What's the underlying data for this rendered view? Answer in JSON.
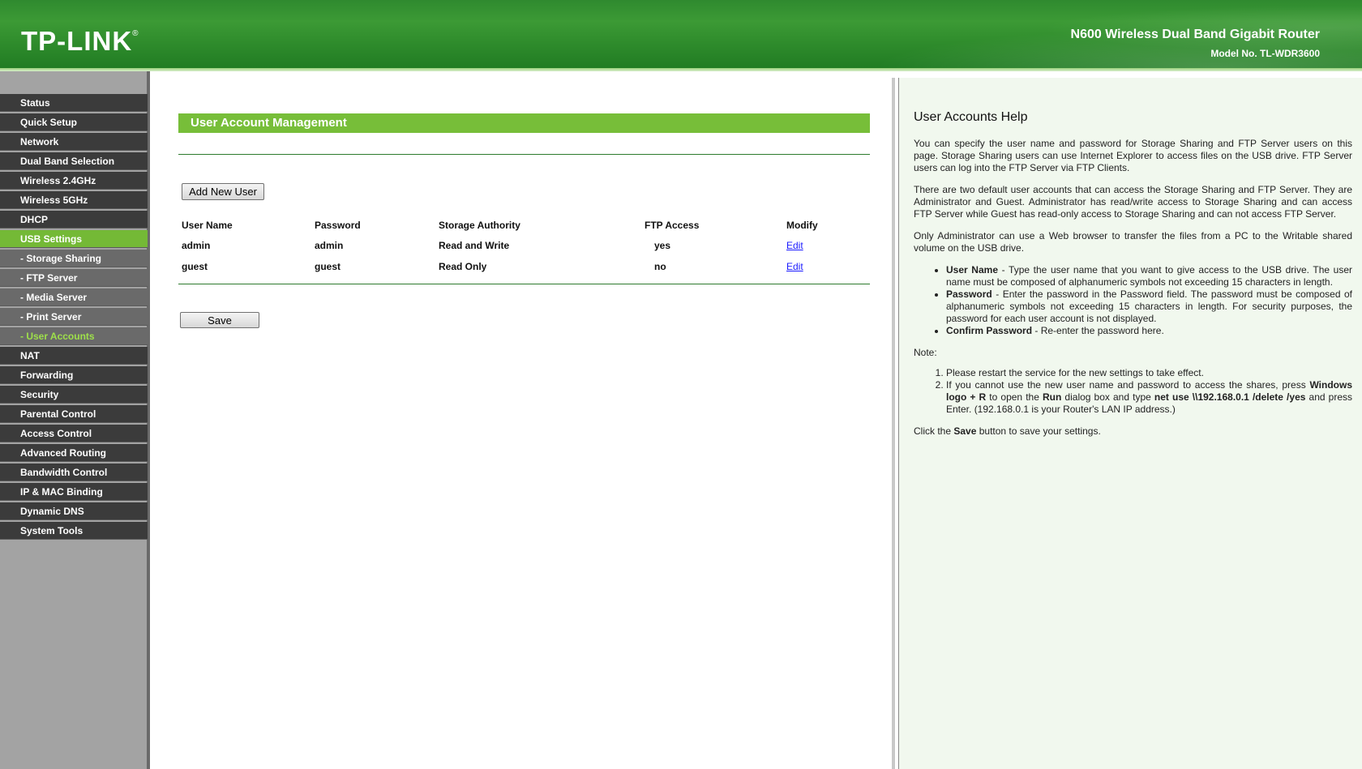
{
  "header": {
    "brand": "TP-LINK",
    "brand_mark": "®",
    "product_name": "N600 Wireless Dual Band Gigabit Router",
    "model_no": "Model No. TL-WDR3600"
  },
  "sidebar": {
    "items": [
      {
        "label": "Status"
      },
      {
        "label": "Quick Setup"
      },
      {
        "label": "Network"
      },
      {
        "label": "Dual Band Selection"
      },
      {
        "label": "Wireless 2.4GHz"
      },
      {
        "label": "Wireless 5GHz"
      },
      {
        "label": "DHCP"
      },
      {
        "label": "USB Settings"
      },
      {
        "label": "- Storage Sharing"
      },
      {
        "label": "- FTP Server"
      },
      {
        "label": "- Media Server"
      },
      {
        "label": "- Print Server"
      },
      {
        "label": "- User Accounts"
      },
      {
        "label": "NAT"
      },
      {
        "label": "Forwarding"
      },
      {
        "label": "Security"
      },
      {
        "label": "Parental Control"
      },
      {
        "label": "Access Control"
      },
      {
        "label": "Advanced Routing"
      },
      {
        "label": "Bandwidth Control"
      },
      {
        "label": "IP & MAC Binding"
      },
      {
        "label": "Dynamic DNS"
      },
      {
        "label": "System Tools"
      }
    ]
  },
  "main": {
    "title": "User Account Management",
    "add_user_label": "Add New User",
    "save_label": "Save",
    "columns": [
      "User Name",
      "Password",
      "Storage Authority",
      "FTP Access",
      "Modify"
    ],
    "rows": [
      {
        "user": "admin",
        "password": "admin",
        "authority": "Read and Write",
        "ftp": "yes",
        "modify": "Edit"
      },
      {
        "user": "guest",
        "password": "guest",
        "authority": "Read Only",
        "ftp": "no",
        "modify": "Edit"
      }
    ]
  },
  "help": {
    "title": "User Accounts Help",
    "p1": "You can specify the user name and password for Storage Sharing and FTP Server users on this page. Storage Sharing users can use Internet Explorer to access files on the USB drive. FTP Server users can log into the FTP Server via FTP Clients.",
    "p2": "There are two default user accounts that can access the Storage Sharing and FTP Server. They are Administrator and Guest. Administrator has read/write access to Storage Sharing and can access FTP Server while Guest has read-only access to Storage Sharing and can not access FTP Server.",
    "p3": "Only Administrator can use a Web browser to transfer the files from a PC to the Writable shared volume on the USB drive.",
    "bullets": [
      {
        "term": "User Name",
        "text": " - Type the user name that you want to give access to the USB drive. The user name must be composed of alphanumeric symbols not exceeding 15 characters in length."
      },
      {
        "term": "Password",
        "text": " - Enter the password in the Password field. The password must be composed of alphanumeric symbols not exceeding 15 characters in length. For security purposes, the password for each user account is not displayed."
      },
      {
        "term": "Confirm Password",
        "text": " - Re-enter the password here."
      }
    ],
    "note_label": "Note:",
    "note1": "Please restart the service for the new settings to take effect.",
    "note2_a": "If you cannot use the new user name and password to access the shares, press ",
    "note2_b": "Windows logo + R",
    "note2_c": " to open the ",
    "note2_d": "Run",
    "note2_e": " dialog box and type ",
    "note2_f": "net use \\\\192.168.0.1 /delete /yes",
    "note2_g": " and press Enter. (192.168.0.1 is your Router's LAN IP address.)",
    "click_a": "Click the ",
    "click_b": "Save",
    "click_c": " button to save your settings."
  }
}
